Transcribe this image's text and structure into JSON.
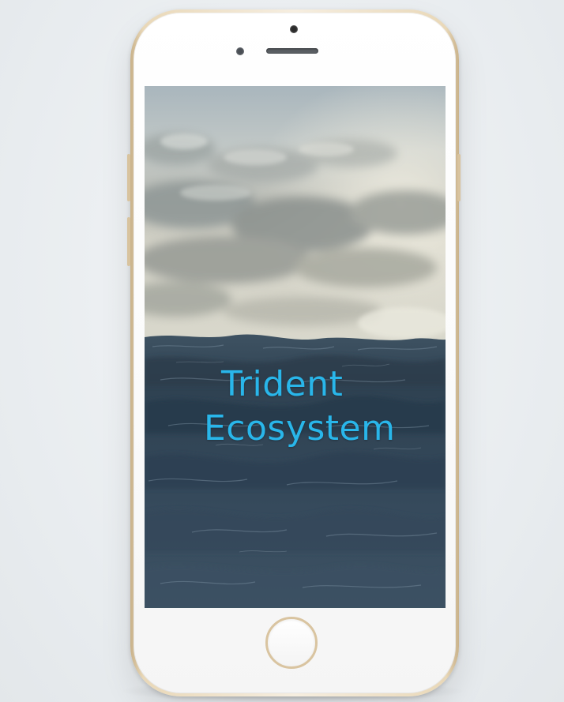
{
  "device": {
    "model": "iphone",
    "color": "gold",
    "frame_color": "#e9d8b8",
    "face_color": "#ffffff"
  },
  "screen": {
    "background": "ocean-waves-cloudy-sky-photo",
    "title_line1": "Trident",
    "title_line2": "Ecosystem",
    "title_color": "#29b6ea"
  },
  "icons": {
    "camera": "front-camera-icon",
    "sensor": "proximity-sensor-icon",
    "speaker": "earpiece-speaker-icon",
    "home": "home-button"
  }
}
